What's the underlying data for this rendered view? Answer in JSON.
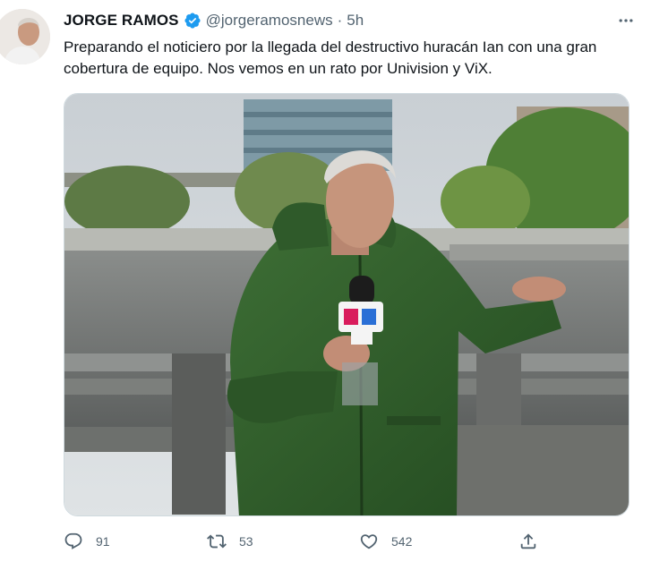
{
  "tweet": {
    "author_name": "JORGE RAMOS",
    "author_handle": "@jorgeramosnews",
    "separator": "·",
    "time": "5h",
    "text": "Preparando el noticiero por la llegada del destructivo huracán Ian con una gran cobertura de equipo. Nos vemos en un rato por Univision y ViX.",
    "verified": true,
    "media_mic_flag": "U"
  },
  "actions": {
    "replies": "91",
    "retweets": "53",
    "likes": "542"
  },
  "icons": {
    "verified": "verified-badge-icon",
    "more": "more-icon",
    "reply": "reply-icon",
    "retweet": "retweet-icon",
    "like": "heart-icon",
    "share": "share-icon"
  },
  "colors": {
    "verified_blue": "#1d9bf0",
    "text": "#0f1419",
    "muted": "#536471",
    "jacket_green": "#2f5a2a"
  }
}
